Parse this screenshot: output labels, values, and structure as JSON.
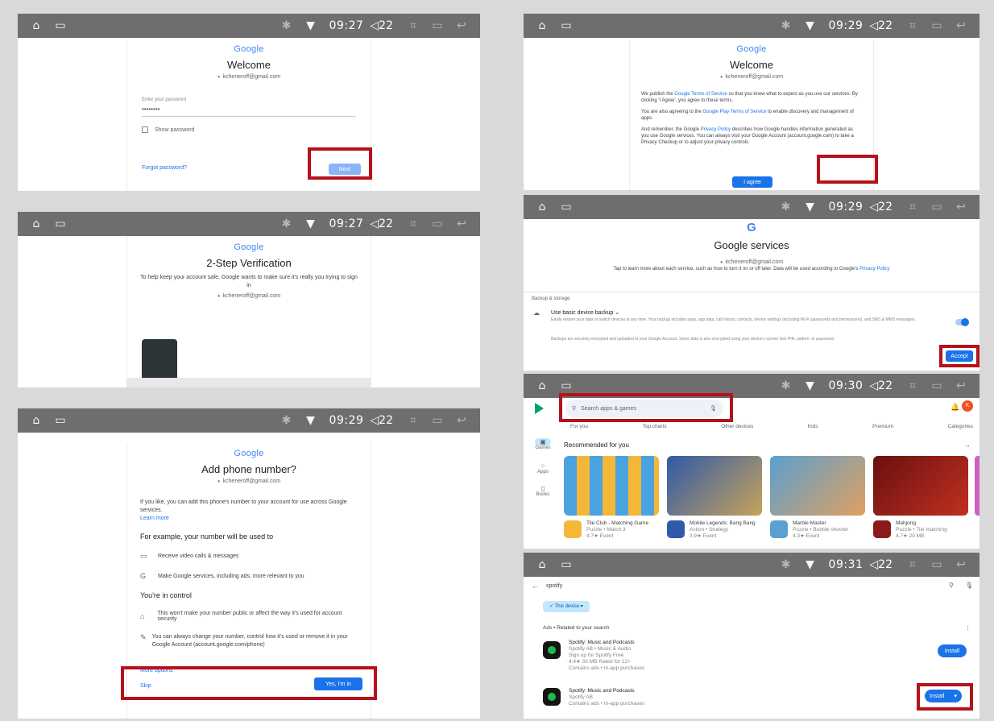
{
  "statusbar": {
    "time1": "09:27",
    "time2": "09:27",
    "time3": "09:29",
    "time4": "09:29",
    "time5": "09:29",
    "time6": "09:30",
    "time7": "09:31",
    "volume": "22"
  },
  "icons": {
    "home": "home-icon",
    "recent": "recent-apps-icon",
    "bluetooth": "bluetooth-icon",
    "wifi": "wifi-icon",
    "volume": "volume-icon",
    "back": "back-icon"
  },
  "google": "Google",
  "account": "kcheneroff@gmail.com",
  "pw": {
    "title": "Welcome",
    "label": "Enter your password",
    "dots": "••••••••",
    "show": "Show password",
    "forgot": "Forgot password?",
    "next": "Next"
  },
  "tsv": {
    "title": "2-Step Verification",
    "desc": "To help keep your account safe, Google wants to make sure it's really you trying to sign in"
  },
  "phone": {
    "title": "Add phone number?",
    "intro": "If you like, you can add this phone's number to your account for use across Google services.",
    "learn": "Learn more",
    "example": "For example, your number will be used to",
    "item1": "Receive video calls & messages",
    "item2": "Make Google services, including ads, more relevant to you",
    "control": "You're in control",
    "item3": "This won't make your number public or affect the way it's used for account security",
    "item4": "You can always change your number, control how it's used or remove it in your Google Account (account.google.com/phone)",
    "more": "More options",
    "skip": "Skip",
    "yes": "Yes, I'm in"
  },
  "terms": {
    "title": "Welcome",
    "p1a": "We publish the ",
    "p1link": "Google Terms of Service",
    "p1b": " so that you know what to expect as you use our services. By clicking 'I Agree', you agree to these terms.",
    "p2a": "You are also agreeing to the ",
    "p2link": "Google Play Terms of Service",
    "p2b": " to enable discovery and management of apps.",
    "p3a": "And remember, the Google ",
    "p3link": "Privacy Policy",
    "p3b": " describes how Google handles information generated as you use Google services. You can always visit your Google Account (account.google.com) to take a Privacy Checkup or to adjust your privacy controls.",
    "agree": "I agree"
  },
  "services": {
    "logo": "G",
    "title": "Google services",
    "sub": "Tap to learn more about each service, such as how to turn it on or off later. Data will be used according to Google's ",
    "sublink": "Privacy Policy",
    "section": "Backup & storage",
    "backup": "Use basic device backup",
    "desc": "Easily restore your data or switch devices at any time. Your backup includes apps, app data, call history, contacts, device settings (including Wi-Fi passwords and permissions), and SMS & MMS messages.",
    "desc2": "Backups are securely encrypted and uploaded to your Google Account. Some data is also encrypted using your device's screen lock PIN, pattern, or password.",
    "accept": "Accept"
  },
  "play": {
    "search": "Search apps & games",
    "tabs": [
      "For you",
      "Top charts",
      "Other devices",
      "Kids",
      "Premium",
      "Categories"
    ],
    "nav": [
      "Games",
      "Apps",
      "Books"
    ],
    "rec": "Recommended for you",
    "avatar": "K",
    "apps": [
      {
        "name": "Tile Club - Matching Game",
        "sub": "Puzzle • Match 3",
        "meta": "4.7★  Event"
      },
      {
        "name": "Mobile Legends: Bang Bang",
        "sub": "Action • Strategy",
        "meta": "3.9★  Event"
      },
      {
        "name": "Marble Master",
        "sub": "Puzzle • Bubble shooter",
        "meta": "4.3★  Event"
      },
      {
        "name": "Mahjong",
        "sub": "Puzzle • Tile matching",
        "meta": "4.7★  20 MB"
      }
    ]
  },
  "search": {
    "query": "spotify",
    "chip": "This device",
    "ads": "Ads • Related to your search",
    "r1": {
      "name": "Spotify: Music and Podcasts",
      "dev": "Spotify AB • Music & Audio",
      "tag": "Sign up for Spotify Free",
      "meta": "4.4★  33 MB  Rated for 12+",
      "extra": "Contains ads • In-app purchases",
      "btn": "Install"
    },
    "r2": {
      "name": "Spotify: Music and Podcasts",
      "dev": "Spotify AB",
      "extra": "Contains ads • In-app purchases",
      "btn": "Install"
    }
  }
}
